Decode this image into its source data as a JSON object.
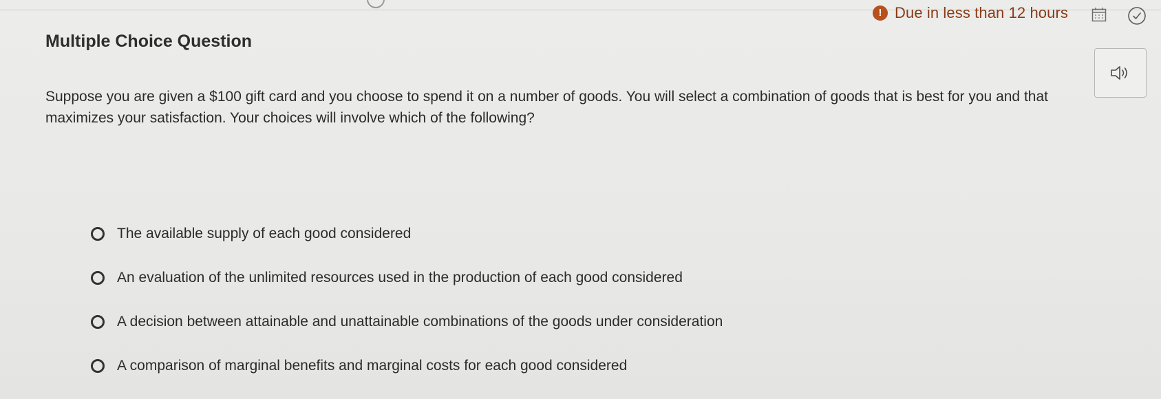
{
  "status": {
    "due_text": "Due in less than 12 hours",
    "alert_symbol": "!"
  },
  "icons": {
    "calendar": "calendar-icon",
    "check": "check-circle-icon",
    "audio": "speaker-icon"
  },
  "question": {
    "heading": "Multiple Choice Question",
    "text": "Suppose you are given a $100 gift card and you choose to spend it on a number of goods. You will select a combination of goods that is best for you and that maximizes your satisfaction. Your choices will involve which of the following?",
    "options": [
      "The available supply of each good considered",
      "An evaluation of the unlimited resources used in the production of each good considered",
      "A decision between attainable and unattainable combinations of the goods under consideration",
      "A comparison of marginal benefits and marginal costs for each good considered"
    ]
  },
  "colors": {
    "due_accent": "#b6501f",
    "background": "#ececea"
  }
}
